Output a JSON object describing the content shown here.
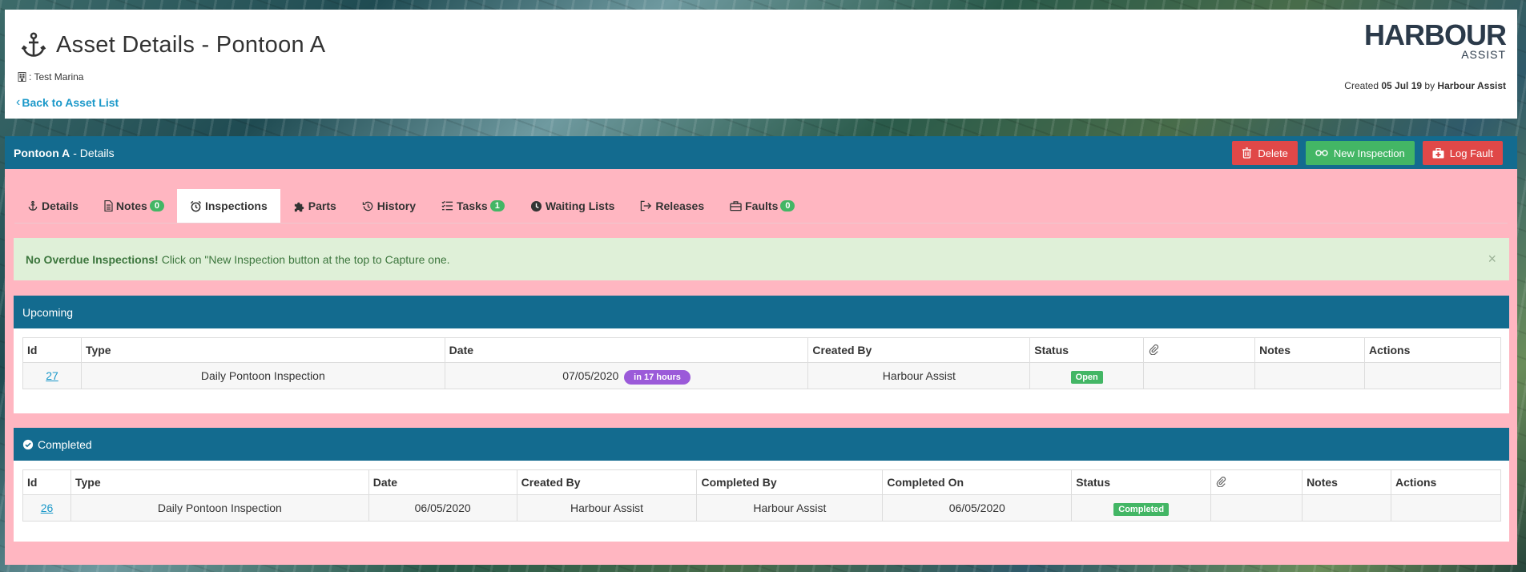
{
  "header": {
    "title": "Asset Details - Pontoon A",
    "location": ": Test Marina",
    "back_link": "Back to Asset List",
    "logo_main": "HARBOUR",
    "logo_sub": "ASSIST",
    "created_prefix": "Created",
    "created_date": "05 Jul 19",
    "created_by_prefix": "by",
    "created_by": "Harbour Assist"
  },
  "details_bar": {
    "asset_name": "Pontoon A",
    "suffix": "- Details",
    "buttons": {
      "delete": "Delete",
      "new_inspection": "New Inspection",
      "log_fault": "Log Fault"
    }
  },
  "tabs": [
    {
      "label": "Details",
      "icon": "anchor-icon"
    },
    {
      "label": "Notes",
      "badge": "0",
      "icon": "file-icon"
    },
    {
      "label": "Inspections",
      "icon": "alarm-clock-icon",
      "active": true
    },
    {
      "label": "Parts",
      "icon": "puzzle-icon"
    },
    {
      "label": "History",
      "icon": "history-icon"
    },
    {
      "label": "Tasks",
      "badge": "1",
      "icon": "tasks-icon"
    },
    {
      "label": "Waiting Lists",
      "icon": "clock-icon"
    },
    {
      "label": "Releases",
      "icon": "sign-out-icon"
    },
    {
      "label": "Faults",
      "badge": "0",
      "icon": "briefcase-icon"
    }
  ],
  "alert": {
    "strong": "No Overdue Inspections!",
    "text": "Click on \"New Inspection button at the top to Capture one.",
    "close": "×"
  },
  "upcoming": {
    "title": "Upcoming",
    "columns": [
      "Id",
      "Type",
      "Date",
      "Created By",
      "Status",
      "",
      "Notes",
      "Actions"
    ],
    "rows": [
      {
        "id": "27",
        "type": "Daily Pontoon Inspection",
        "date": "07/05/2020",
        "due": "in 17 hours",
        "created_by": "Harbour Assist",
        "status": "Open",
        "notes": "",
        "actions": ""
      }
    ]
  },
  "completed": {
    "title": "Completed",
    "columns": [
      "Id",
      "Type",
      "Date",
      "Created By",
      "Completed By",
      "Completed On",
      "Status",
      "",
      "Notes",
      "Actions"
    ],
    "rows": [
      {
        "id": "26",
        "type": "Daily Pontoon Inspection",
        "date": "06/05/2020",
        "created_by": "Harbour Assist",
        "completed_by": "Harbour Assist",
        "completed_on": "06/05/2020",
        "status": "Completed",
        "notes": "",
        "actions": ""
      }
    ]
  },
  "colors": {
    "primary": "#136b8f",
    "danger": "#e04848",
    "success": "#43b665",
    "content_bg": "#ffb6c1",
    "link": "#1a98c9",
    "due_badge": "#9b5ad9"
  }
}
